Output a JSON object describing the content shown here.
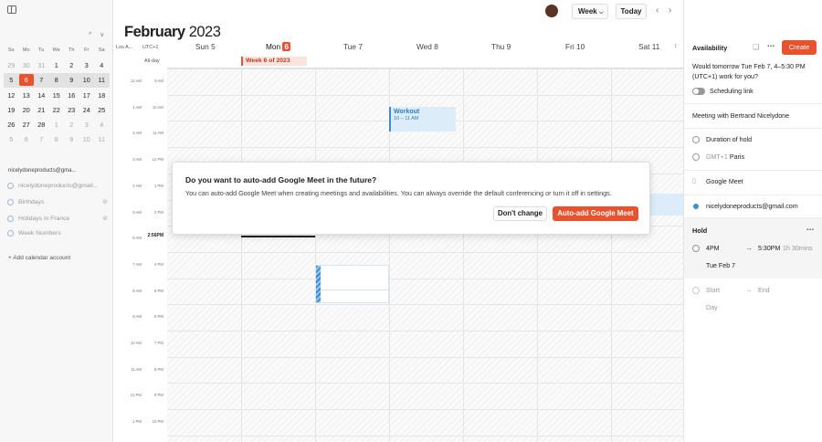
{
  "header": {
    "month": "February",
    "year": "2023",
    "view_button": "Week",
    "today_button": "Today",
    "prev": "‹",
    "next": "›"
  },
  "mini_calendar": {
    "nav_prev": "^",
    "nav_next": "v",
    "weekdays": [
      "Su",
      "Mo",
      "Tu",
      "We",
      "Th",
      "Fr",
      "Sa"
    ],
    "weeks": [
      [
        "29",
        "30",
        "31",
        "1",
        "2",
        "3",
        "4"
      ],
      [
        "5",
        "6",
        "7",
        "8",
        "9",
        "10",
        "11"
      ],
      [
        "12",
        "13",
        "14",
        "15",
        "16",
        "17",
        "18"
      ],
      [
        "19",
        "20",
        "21",
        "22",
        "23",
        "24",
        "25"
      ],
      [
        "26",
        "27",
        "28",
        "1",
        "2",
        "3",
        "4"
      ],
      [
        "5",
        "6",
        "7",
        "8",
        "9",
        "10",
        "11"
      ]
    ]
  },
  "sidebar": {
    "account": "nicelydoneproducts@gma...",
    "calendars": [
      {
        "label": "nicelydoneproducts@gmail...",
        "hidden": false
      },
      {
        "label": "Birthdays",
        "hidden": true
      },
      {
        "label": "Holidays in France",
        "hidden": true
      },
      {
        "label": "Week Numbers",
        "hidden": false
      }
    ],
    "add_account": "+ Add calendar account"
  },
  "week": {
    "tz_label": "Los A...",
    "tz_label2": "UTC+1",
    "allday_label": "All-day",
    "days": [
      {
        "name": "Sun",
        "num": "5",
        "current": false
      },
      {
        "name": "Mon",
        "num": "6",
        "current": true
      },
      {
        "name": "Tue",
        "num": "7",
        "current": false
      },
      {
        "name": "Wed",
        "num": "8",
        "current": false
      },
      {
        "name": "Thu",
        "num": "9",
        "current": false
      },
      {
        "name": "Fri",
        "num": "10",
        "current": false
      },
      {
        "name": "Sat",
        "num": "11",
        "current": false
      }
    ],
    "allday_event": "Week 6 of 2023",
    "hours_tz1": [
      "12 AM",
      "1 AM",
      "2 AM",
      "3 AM",
      "4 AM",
      "5 AM",
      "6 AM",
      "7 AM",
      "8 AM",
      "9 AM",
      "10 AM",
      "11 AM",
      "12 PM",
      "1 PM"
    ],
    "hours_tz2": [
      "9 AM",
      "10 AM",
      "11 AM",
      "12 PM",
      "1 PM",
      "2 PM",
      "",
      "4 PM",
      "5 PM",
      "6 PM",
      "7 PM",
      "8 PM",
      "9 PM",
      "10 PM"
    ],
    "now_time": "2:56PM",
    "workout": {
      "title": "Workout",
      "time": "10 – 11 AM"
    }
  },
  "dialog": {
    "title": "Do you want to auto-add Google Meet in the future?",
    "body": "You can auto-add Google Meet when creating meetings and availabilities. You can always override the default conferencing or turn it off in settings.",
    "cancel": "Don't change",
    "confirm": "Auto-add Google Meet"
  },
  "panel": {
    "title": "Availability",
    "create": "Create",
    "proposal": "Would tomorrow Tue Feb 7, 4–5:30 PM (UTC+1) work for you?",
    "scheduling_link": "Scheduling link",
    "meeting_title": "Meeting with Bertrand Nicelydone",
    "duration": "Duration of hold",
    "tz_prefix": "GMT+1",
    "tz_city": "Paris",
    "conferencing": "Google Meet",
    "calendar": "nicelydoneproducts@gmail.com",
    "hold_title": "Hold",
    "hold_start": "4PM",
    "hold_end": "5:30PM",
    "hold_duration": "1h 30mins",
    "hold_date": "Tue Feb 7",
    "start_placeholder": "Start",
    "end_placeholder": "End",
    "day_placeholder": "Day"
  }
}
